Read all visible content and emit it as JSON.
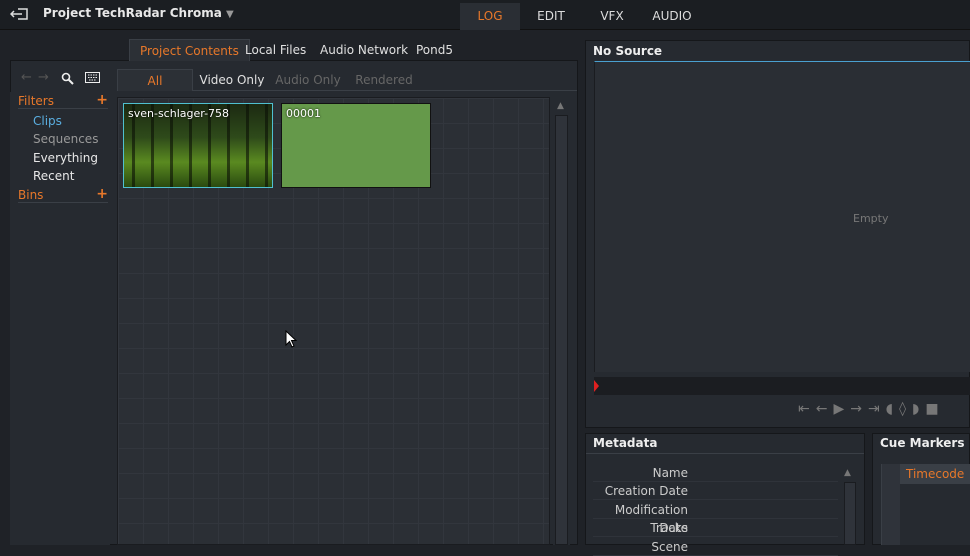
{
  "app": {
    "project_title": "Project TechRadar Chroma",
    "exit_icon": "exit-icon",
    "dropdown_icon": "caret-down-icon"
  },
  "main_tabs": [
    {
      "label": "LOG",
      "active": true
    },
    {
      "label": "EDIT"
    },
    {
      "label": "VFX"
    },
    {
      "label": "AUDIO"
    }
  ],
  "source_tabs": [
    {
      "label": "Project Contents",
      "active": true
    },
    {
      "label": "Local Files"
    },
    {
      "label": "Audio Network"
    },
    {
      "label": "Pond5"
    }
  ],
  "sidebar": {
    "filters_label": "Filters",
    "items": [
      {
        "label": "Clips",
        "selected": true
      },
      {
        "label": "Sequences"
      },
      {
        "label": "Everything"
      },
      {
        "label": "Recent"
      }
    ],
    "bins_label": "Bins",
    "plus": "+"
  },
  "filter_tabs": [
    {
      "label": "All",
      "active": true
    },
    {
      "label": "Video Only"
    },
    {
      "label": "Audio Only",
      "disabled": true
    },
    {
      "label": "Rendered",
      "disabled": true
    }
  ],
  "clips": [
    {
      "name": "sven-schlager-758"
    },
    {
      "name": "00001"
    }
  ],
  "viewer": {
    "title": "No Source",
    "empty_label": "Empty"
  },
  "metadata": {
    "title": "Metadata",
    "fields": [
      "Name",
      "Creation Date",
      "Modification Date",
      "Tracks",
      "Scene"
    ]
  },
  "cue_markers": {
    "title": "Cue Markers",
    "column": "Timecode"
  },
  "colors": {
    "accent": "#e8782a",
    "selected": "#5aaee0"
  }
}
